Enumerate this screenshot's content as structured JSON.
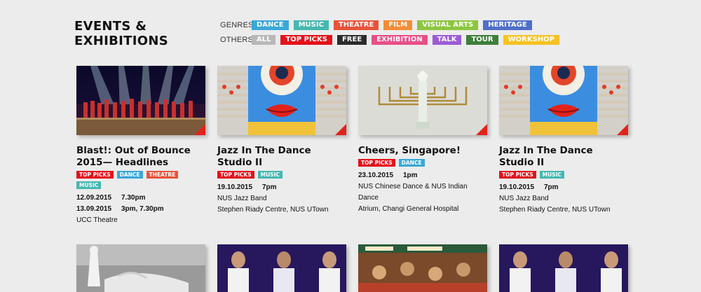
{
  "page": {
    "title_line1": "EVENTS &",
    "title_line2": "EXHIBITIONS"
  },
  "filters": {
    "genres_label": "GENRES",
    "others_label": "OTHERS",
    "genres": [
      {
        "label": "DANCE",
        "color": "#3aa8d8"
      },
      {
        "label": "MUSIC",
        "color": "#45b8b0"
      },
      {
        "label": "THEATRE",
        "color": "#e8533a"
      },
      {
        "label": "FILM",
        "color": "#f28c38"
      },
      {
        "label": "VISUAL ARTS",
        "color": "#8cc63f"
      },
      {
        "label": "HERITAGE",
        "color": "#4f6ec9"
      }
    ],
    "others": [
      {
        "label": "ALL",
        "color": "#b8b8b8"
      },
      {
        "label": "TOP PICKS",
        "color": "#e2121a"
      },
      {
        "label": "FREE",
        "color": "#2c2c2c"
      },
      {
        "label": "EXHIBITION",
        "color": "#e84f86"
      },
      {
        "label": "TALK",
        "color": "#9c5bd6"
      },
      {
        "label": "TOUR",
        "color": "#3e7f3a"
      },
      {
        "label": "WORKSHOP",
        "color": "#f6c223"
      }
    ]
  },
  "cards": [
    {
      "title": "Blast!: Out of Bounce 2015— Headlines",
      "image": "stage-performance-photo",
      "tags": [
        {
          "label": "TOP PICKS",
          "color": "#e2121a"
        },
        {
          "label": "DANCE",
          "color": "#3aa8d8"
        },
        {
          "label": "THEATRE",
          "color": "#e8533a"
        },
        {
          "label": "MUSIC",
          "color": "#45b8b0"
        }
      ],
      "schedule": [
        {
          "date": "12.09.2015",
          "time": "7.30pm"
        },
        {
          "date": "13.09.2015",
          "time": "3pm, 7.30pm"
        }
      ],
      "lines": [
        "UCC Theatre"
      ]
    },
    {
      "title": "Jazz In The Dance Studio II",
      "image": "jazz-poster-art",
      "tags": [
        {
          "label": "TOP PICKS",
          "color": "#e2121a"
        },
        {
          "label": "MUSIC",
          "color": "#45b8b0"
        }
      ],
      "schedule": [
        {
          "date": "19.10.2015",
          "time": "7pm"
        }
      ],
      "lines": [
        "NUS Jazz Band",
        "Stephen Riady Centre, NUS UTown"
      ]
    },
    {
      "title": "Cheers, Singapore!",
      "image": "candelabra-photo",
      "tags": [
        {
          "label": "TOP PICKS",
          "color": "#e2121a"
        },
        {
          "label": "DANCE",
          "color": "#3aa8d8"
        }
      ],
      "schedule": [
        {
          "date": "23.10.2015",
          "time": "1pm"
        }
      ],
      "lines": [
        "NUS Chinese Dance & NUS Indian Dance",
        "Atrium, Changi General Hospital"
      ]
    },
    {
      "title": "Jazz In The Dance Studio II",
      "image": "jazz-poster-art",
      "tags": [
        {
          "label": "TOP PICKS",
          "color": "#e2121a"
        },
        {
          "label": "MUSIC",
          "color": "#45b8b0"
        }
      ],
      "schedule": [
        {
          "date": "19.10.2015",
          "time": "7pm"
        }
      ],
      "lines": [
        "NUS Jazz Band",
        "Stephen Riady Centre, NUS UTown"
      ]
    }
  ],
  "bottom_row": [
    {
      "image": "white-sculpture-photo"
    },
    {
      "image": "band-performance-photo"
    },
    {
      "image": "painted-mural-photo"
    },
    {
      "image": "band-performance-photo"
    }
  ]
}
